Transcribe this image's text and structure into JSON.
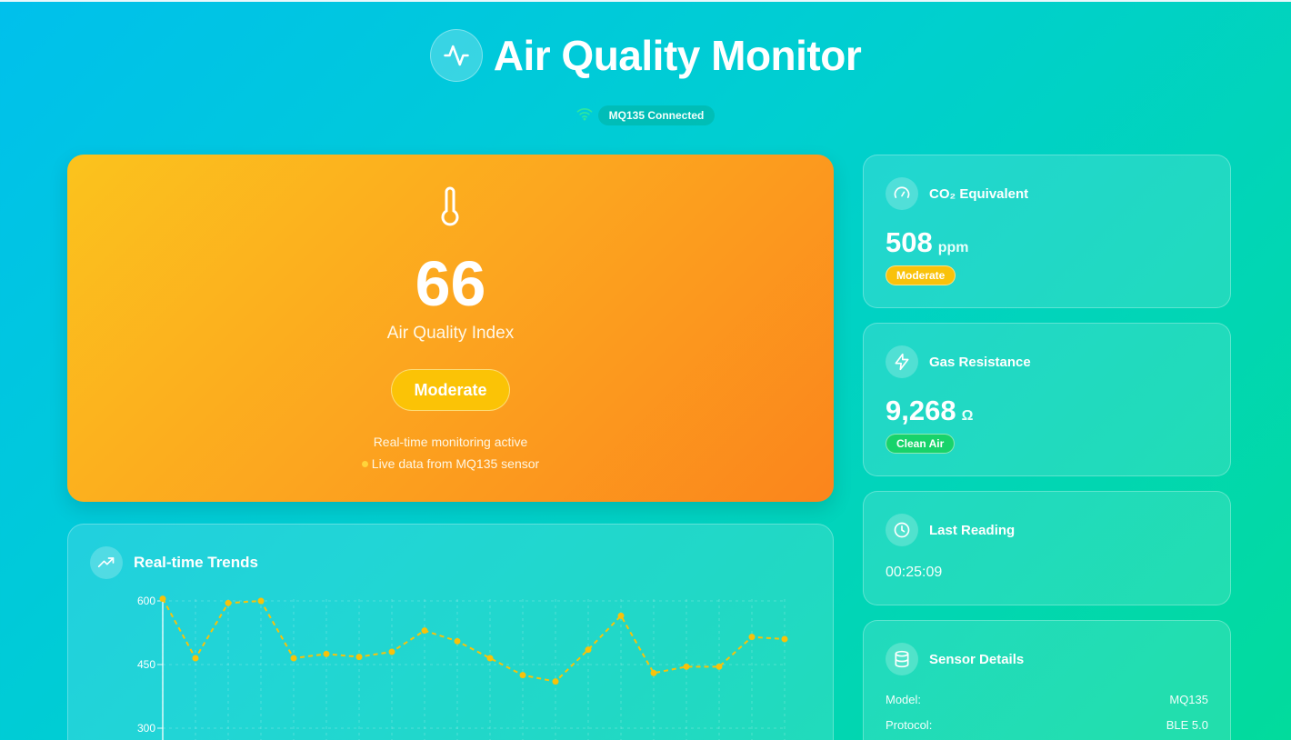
{
  "header": {
    "title": "Air Quality Monitor",
    "connection_status": "MQ135 Connected"
  },
  "aqi": {
    "value": "66",
    "label": "Air Quality Index",
    "status": "Moderate",
    "monitoring_text": "Real-time monitoring active",
    "live_text": "Live data from MQ135 sensor"
  },
  "trends": {
    "title": "Real-time Trends",
    "chart_data": {
      "type": "line",
      "x": [
        1,
        2,
        3,
        4,
        5,
        6,
        7,
        8,
        9,
        10,
        11,
        12,
        13,
        14,
        15,
        16,
        17,
        18,
        19,
        20
      ],
      "series": [
        {
          "values": [
            605,
            465,
            595,
            600,
            465,
            475,
            468,
            480,
            530,
            505,
            465,
            425,
            410,
            485,
            565,
            430,
            445,
            445,
            515,
            510
          ]
        }
      ],
      "ylim": [
        250,
        610
      ],
      "yticks": [
        600,
        450,
        300
      ],
      "grid": true,
      "line_color": "#f8c20a",
      "line_style": "dashed"
    }
  },
  "co2": {
    "title": "CO₂ Equivalent",
    "value": "508",
    "unit": "ppm",
    "status": "Moderate"
  },
  "gas": {
    "title": "Gas Resistance",
    "value": "9,268",
    "unit": "Ω",
    "status": "Clean Air"
  },
  "last_reading": {
    "title": "Last Reading",
    "time": "00:25:09"
  },
  "sensor": {
    "title": "Sensor Details",
    "rows": [
      {
        "label": "Model:",
        "value": "MQ135"
      },
      {
        "label": "Protocol:",
        "value": "BLE 5.0"
      }
    ]
  },
  "colors": {
    "accent_yellow": "#fbc306",
    "clean_green": "#18d36a",
    "wifi_green": "#2ee6a0"
  }
}
